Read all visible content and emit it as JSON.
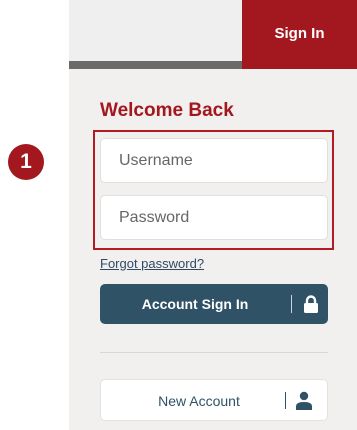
{
  "header": {
    "signin_tab": "Sign In"
  },
  "step": {
    "number": "1"
  },
  "form": {
    "heading": "Welcome Back",
    "username_placeholder": "Username",
    "password_placeholder": "Password",
    "forgot_link": "Forgot password?",
    "signin_button": "Account Sign In",
    "signin_icon": "lock-icon",
    "new_account_button": "New Account",
    "new_account_icon": "user-icon"
  },
  "colors": {
    "brand_red": "#a3171f",
    "button_blue": "#2f5266",
    "panel_bg": "#f1f0ef"
  }
}
